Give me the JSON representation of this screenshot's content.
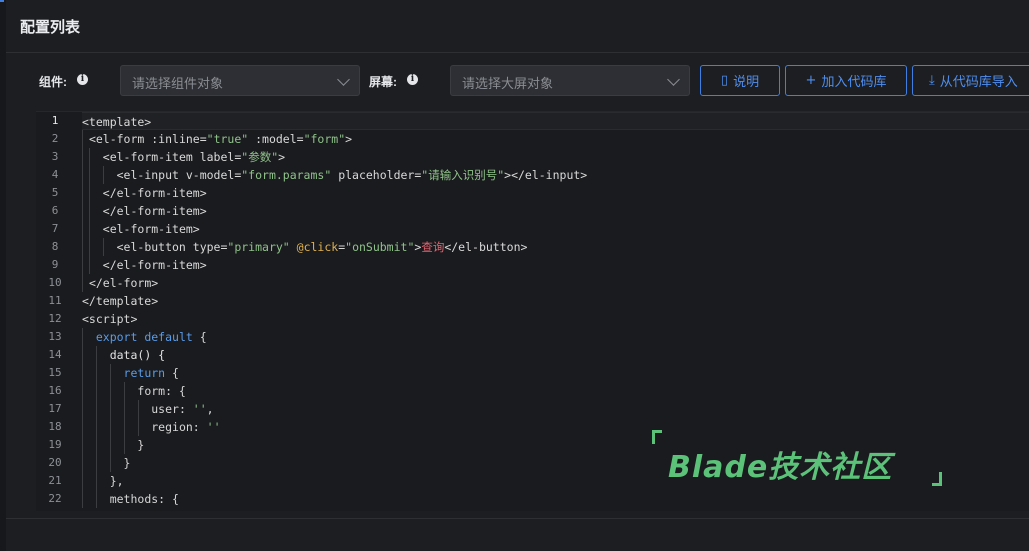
{
  "header": {
    "title": "配置列表"
  },
  "toolbar": {
    "component_label": "组件:",
    "component_placeholder": "请选择组件对象",
    "screen_label": "屏幕:",
    "screen_placeholder": "请选择大屏对象",
    "info_glyph": "i",
    "explain_label": "说明",
    "add_code_label": "加入代码库",
    "import_code_label": "从代码库导入",
    "icons": {
      "explain": "book-icon",
      "add": "plus-icon",
      "import": "download-icon"
    }
  },
  "editor": {
    "line_numbers": [
      "1",
      "2",
      "3",
      "4",
      "5",
      "6",
      "7",
      "8",
      "9",
      "10",
      "11",
      "12",
      "13",
      "14",
      "15",
      "16",
      "17",
      "18",
      "19",
      "20",
      "21",
      "22"
    ],
    "lines": {
      "l1": {
        "a": "<template>"
      },
      "l2": {
        "a": "<el-form :inline=",
        "b": "\"true\"",
        "c": " :model=",
        "d": "\"form\"",
        "e": ">"
      },
      "l3": {
        "a": "<el-form-item label=",
        "b": "\"参数\"",
        "c": ">"
      },
      "l4": {
        "a": "<el-input v-model=",
        "b": "\"form.params\"",
        "c": " placeholder=",
        "d": "\"请输入识别号\"",
        "e": "></el-input>"
      },
      "l5": {
        "a": "</el-form-item>"
      },
      "l6": {
        "a": "</el-form-item>"
      },
      "l7": {
        "a": "<el-form-item>"
      },
      "l8": {
        "a": "<el-button type=",
        "b": "\"primary\"",
        "c": " ",
        "d": "@click",
        "e": "=",
        "f": "\"onSubmit\"",
        "g": ">",
        "h": "查询",
        "i": "</el-button>"
      },
      "l9": {
        "a": "</el-form-item>"
      },
      "l10": {
        "a": "</el-form>"
      },
      "l11": {
        "a": "</template>"
      },
      "l12": {
        "a": "<script>"
      },
      "l13": {
        "a": "export default",
        "b": " {"
      },
      "l14": {
        "a": "data() {"
      },
      "l15": {
        "a": "return",
        "b": " {"
      },
      "l16": {
        "a": "form: {"
      },
      "l17": {
        "a": "user: ",
        "b": "''",
        "c": ","
      },
      "l18": {
        "a": "region: ",
        "b": "''"
      },
      "l19": {
        "a": "}"
      },
      "l20": {
        "a": "}"
      },
      "l21": {
        "a": "},"
      },
      "l22": {
        "a": "methods: {"
      }
    }
  },
  "watermark": {
    "text": "Blade技术社区"
  },
  "colors": {
    "accent": "#3f7fe4",
    "string": "#8fc28a",
    "keyword": "#5a9be8",
    "event": "#e0b14e",
    "watermark": "#5cc27a"
  }
}
